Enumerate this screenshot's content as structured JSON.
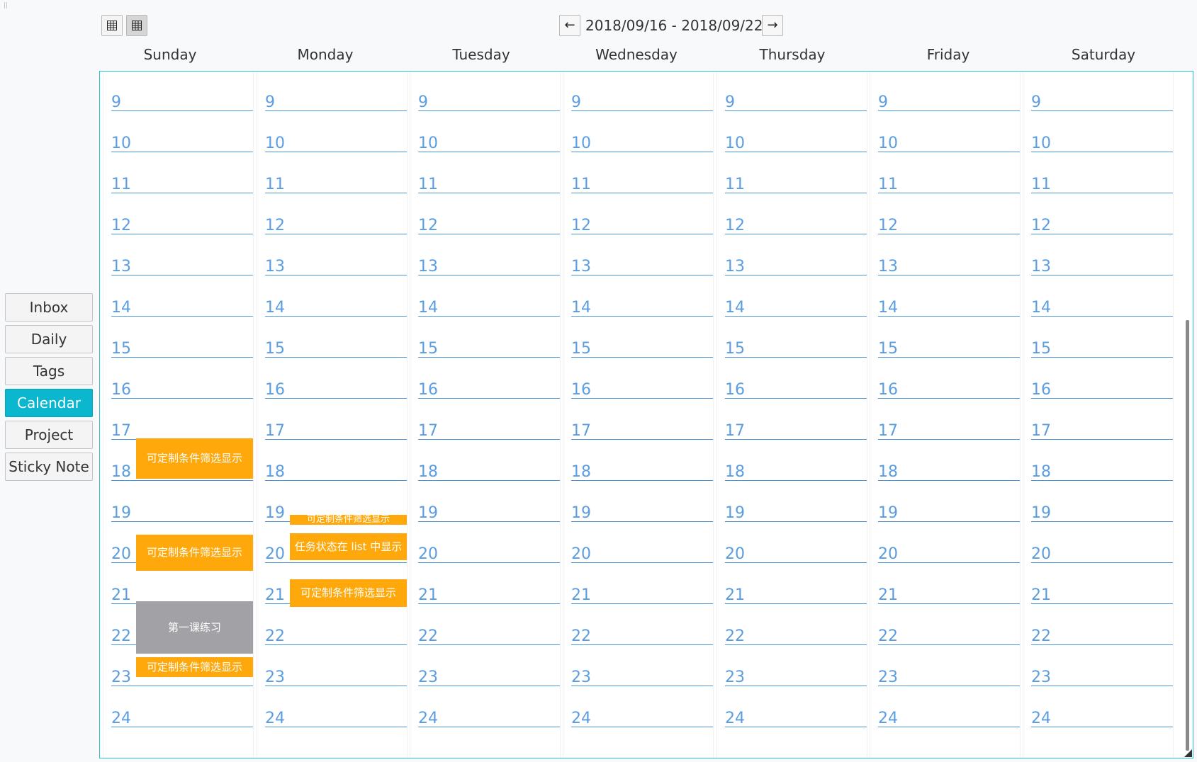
{
  "toolbar": {
    "view_buttons": [
      "list-view-icon",
      "grid-view-icon"
    ],
    "prev_icon": "←",
    "next_icon": "→",
    "date_range": "2018/09/16 - 2018/09/22"
  },
  "sidebar": {
    "items": [
      {
        "label": "Inbox",
        "active": false
      },
      {
        "label": "Daily",
        "active": false
      },
      {
        "label": "Tags",
        "active": false
      },
      {
        "label": "Calendar",
        "active": true
      },
      {
        "label": "Project",
        "active": false
      },
      {
        "label": "Sticky Note",
        "active": false
      }
    ]
  },
  "calendar": {
    "days": [
      "Sunday",
      "Monday",
      "Tuesday",
      "Wednesday",
      "Thursday",
      "Friday",
      "Saturday"
    ],
    "hours": [
      "9",
      "10",
      "11",
      "12",
      "13",
      "14",
      "15",
      "16",
      "17",
      "18",
      "19",
      "20",
      "21",
      "22",
      "23",
      "24"
    ],
    "events": [
      {
        "day": 0,
        "label": "可定制条件筛选显示",
        "color": "#ffa80b"
      },
      {
        "day": 0,
        "label": "可定制条件筛选显示",
        "color": "#ffa80b"
      },
      {
        "day": 0,
        "label": "第一课练习",
        "color": "#a2a2a6"
      },
      {
        "day": 0,
        "label": "可定制条件筛选显示",
        "color": "#ffa80b"
      },
      {
        "day": 1,
        "label": "可定制条件筛选显示",
        "color": "#ffa80b"
      },
      {
        "day": 1,
        "label": "任务状态在 list 中显示",
        "color": "#ffa80b"
      },
      {
        "day": 1,
        "label": "可定制条件筛选显示",
        "color": "#ffa80b"
      }
    ]
  },
  "colors": {
    "accent": "#0bb6cf",
    "hour_text": "#5a9de0",
    "event_orange": "#ffa80b",
    "event_gray": "#a2a2a6"
  }
}
